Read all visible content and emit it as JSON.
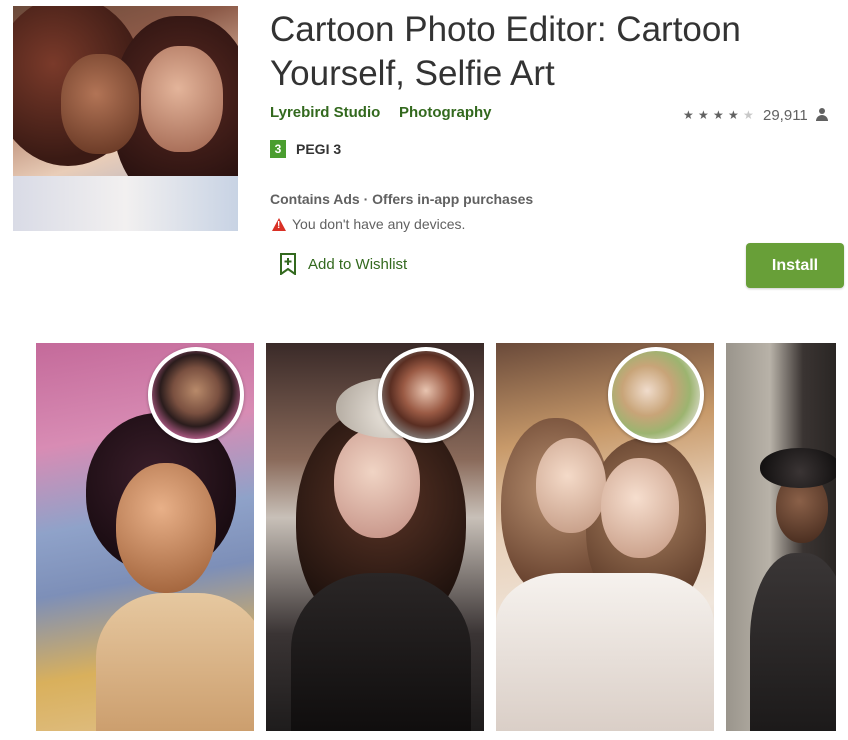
{
  "app": {
    "title": "Cartoon Photo Editor: Cartoon Yourself, Selfie Art",
    "developer": "Lyrebird Studio",
    "category": "Photography",
    "rating_stars": 4,
    "rating_max": 5,
    "rating_count": "29,911",
    "pegi_badge": "3",
    "pegi_label": "PEGI 3",
    "ads_notice": "Contains Ads · Offers in-app purchases",
    "device_warning": "You don't have any devices.",
    "wishlist_label": "Add to Wishlist",
    "install_label": "Install"
  },
  "colors": {
    "accent_green": "#33691e",
    "install_button": "#689f38",
    "warning_red": "#d93025",
    "pegi_green": "#4a9d2f"
  },
  "icons": {
    "warning": "warning-triangle-icon",
    "wishlist": "bookmark-plus-icon",
    "rating_user": "person-icon",
    "star": "star-icon"
  },
  "screenshots": [
    {
      "description_key": "screenshot-1"
    },
    {
      "description_key": "screenshot-2"
    },
    {
      "description_key": "screenshot-3"
    },
    {
      "description_key": "screenshot-4"
    }
  ]
}
